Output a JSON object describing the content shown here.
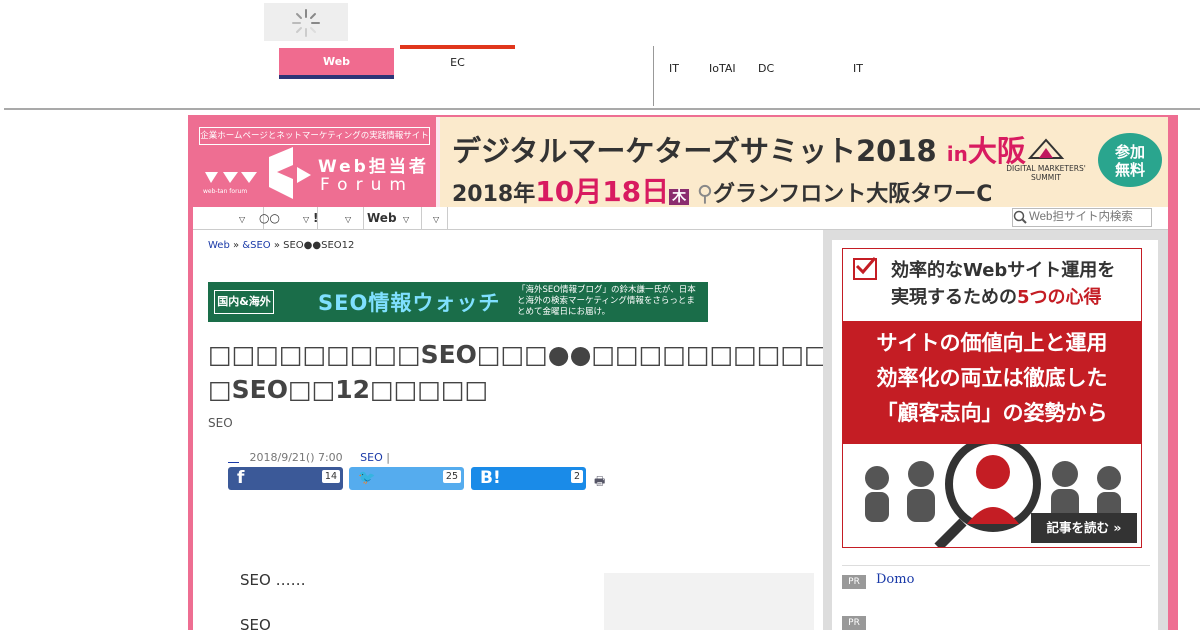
{
  "topbar": {
    "tabs": [
      {
        "label": "Web",
        "active": true
      },
      {
        "label": "EC",
        "active": false
      }
    ],
    "links": [
      "IT",
      "IoTAI",
      "DC",
      "IT"
    ]
  },
  "header": {
    "logo_tagline": "企業ホームページとネットマーケティングの実践情報サイト",
    "logo_line1": "Web担当者",
    "logo_line2": "Forum",
    "logo_sub": "web-tan forum",
    "banner": {
      "title": "デジタルマーケターズサミット2018",
      "title_in": "in",
      "title_city": "大阪",
      "date_prefix": "2018年",
      "date_main": "10月18日",
      "date_day": "木",
      "venue": "グランフロント大阪タワーC",
      "sponsor_line1": "DIGITAL MARKETERS'",
      "sponsor_line2": "SUMMIT",
      "badge_line1": "参加",
      "badge_line2": "無料"
    }
  },
  "nav": {
    "items": [
      "",
      "○○",
      "!",
      "",
      "Web",
      ""
    ],
    "search_placeholder": "Web担サイト内検索"
  },
  "breadcrumb": {
    "home": "Web",
    "section": "&SEO",
    "current": "SEO●●SEO12"
  },
  "seo_banner": {
    "tag": "国内&海外",
    "title": "SEO情報ウォッチ",
    "description": "「海外SEO情報ブログ」の鈴木謙一氏が、日本と海外の検索マーケティング情報をさらっとまとめて金曜日にお届け。"
  },
  "article": {
    "title_line1": "□□□□□□□□□SEO□□□●●□□□□□□□□□□□□□□□□",
    "title_line2": "□SEO□□12□□□□□",
    "category": "SEO",
    "author": "＿",
    "datetime": "2018/9/21() 7:00",
    "category_link": "SEO",
    "separator": "|",
    "share": {
      "facebook_count": "14",
      "twitter_count": "25",
      "hatena_count": "2"
    },
    "paragraph1": "SEO ……",
    "paragraph2": "SEO"
  },
  "sidebar": {
    "ad": {
      "head_line1": "効率的なWebサイト運用を",
      "head_line2_a": "実現するための",
      "head_line2_b": "5つの心得",
      "mid_line1": "サイトの価値向上と運用",
      "mid_line2": "効率化の両立は徹底した",
      "mid_line3": "「顧客志向」の姿勢から",
      "read_more": "記事を読む »"
    },
    "pr_items": [
      {
        "tag": "PR",
        "text": "Domo"
      },
      {
        "tag": "PR",
        "text": ""
      }
    ]
  },
  "colors": {
    "brand_pink": "#ee6e92",
    "nav_blue": "#2c3577",
    "ec_red": "#e0361c",
    "seo_green": "#1a6d49",
    "ad_red": "#c41d24"
  }
}
